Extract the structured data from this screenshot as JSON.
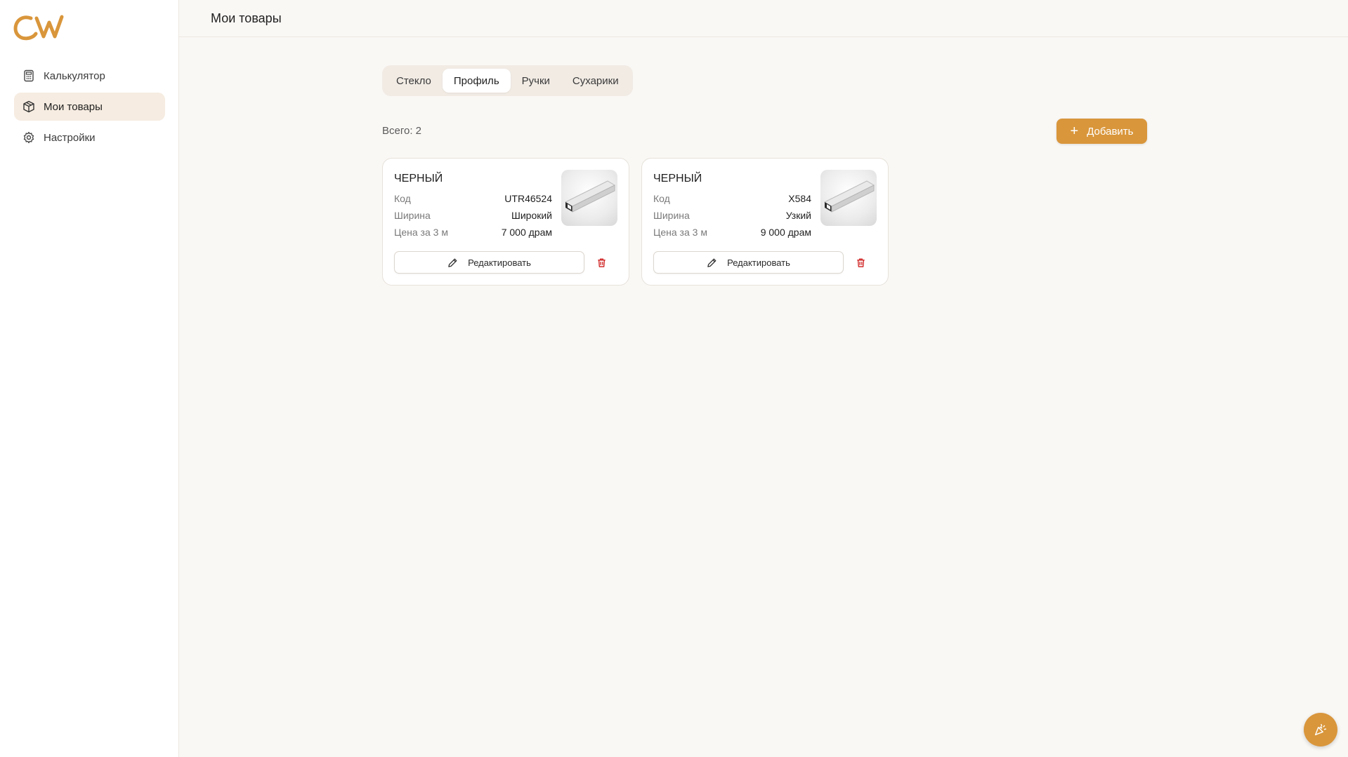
{
  "brand": {
    "accent": "#d9963b",
    "logo_icon": "cw-logo"
  },
  "sidebar": {
    "items": [
      {
        "label": "Калькулятор",
        "icon": "calculator-icon",
        "active": false
      },
      {
        "label": "Мои товары",
        "icon": "package-icon",
        "active": true
      },
      {
        "label": "Настройки",
        "icon": "gear-icon",
        "active": false
      }
    ]
  },
  "header": {
    "title": "Мои товары"
  },
  "tabs": [
    {
      "label": "Стекло",
      "active": false
    },
    {
      "label": "Профиль",
      "active": true
    },
    {
      "label": "Ручки",
      "active": false
    },
    {
      "label": "Сухарики",
      "active": false
    }
  ],
  "toolbar": {
    "count_text": "Всего: 2",
    "add_label": "Добавить"
  },
  "products": [
    {
      "name": "ЧЕРНЫЙ",
      "specs": [
        {
          "label": "Код",
          "value": "UTR46524"
        },
        {
          "label": "Ширина",
          "value": "Широкий"
        },
        {
          "label": "Цена за 3 м",
          "value": "7 000 драм"
        }
      ],
      "edit_label": "Редактировать"
    },
    {
      "name": "ЧЕРНЫЙ",
      "specs": [
        {
          "label": "Код",
          "value": "X584"
        },
        {
          "label": "Ширина",
          "value": "Узкий"
        },
        {
          "label": "Цена за 3 м",
          "value": "9 000 драм"
        }
      ],
      "edit_label": "Редактировать"
    }
  ],
  "colors": {
    "delete": "#d22b2b",
    "background": "#faf8f5",
    "active_nav": "#f6ece1"
  }
}
